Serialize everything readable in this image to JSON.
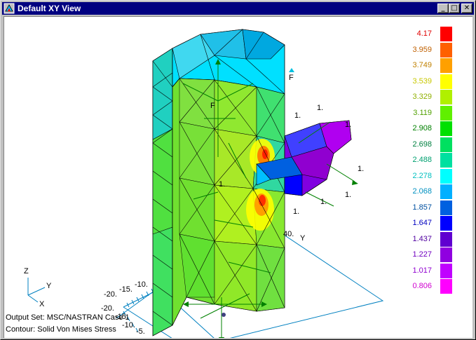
{
  "window": {
    "title": "Default XY View",
    "minimize_glyph": "_",
    "maximize_glyph": "□",
    "close_glyph": "✕"
  },
  "legend": {
    "values": [
      "4.17",
      "3.959",
      "3.749",
      "3.539",
      "3.329",
      "3.119",
      "2.908",
      "2.698",
      "2.488",
      "2.278",
      "2.068",
      "1.857",
      "1.647",
      "1.437",
      "1.227",
      "1.017",
      "0.806"
    ],
    "colors": [
      "#ff0000",
      "#ff6000",
      "#ffa000",
      "#ffff00",
      "#b0f000",
      "#60f000",
      "#00e000",
      "#00e060",
      "#00e0a0",
      "#00ffff",
      "#00b0ff",
      "#0060e0",
      "#0000ff",
      "#6000d0",
      "#9000e0",
      "#c000ff",
      "#ff00ff"
    ],
    "label_colors": [
      "#e00000",
      "#c06000",
      "#c08000",
      "#c8c800",
      "#90b000",
      "#50a000",
      "#008000",
      "#008040",
      "#00a070",
      "#00c0c0",
      "#0090c0",
      "#0050a0",
      "#0000c0",
      "#5000a0",
      "#7000c0",
      "#9000d0",
      "#d000d0"
    ]
  },
  "info": {
    "output_set": "Output Set: MSC/NASTRAN Case 1",
    "contour": "Contour: Solid Von Mises Stress"
  },
  "axes_triad": {
    "z": "Z",
    "y": "Y",
    "x": "X"
  },
  "model_labels": {
    "force_label": "F",
    "force_label_2": "F",
    "constraint_labels": [
      "1.",
      "1.",
      "1.",
      "1.",
      "1.",
      "1.",
      "1.",
      "1."
    ],
    "grid_y_label": "Y",
    "grid_tick_40": "40.",
    "ticks": [
      "-20.",
      "-15.",
      "-10.",
      "-20.",
      "-15.",
      "-10.",
      "-5."
    ]
  },
  "colors": {
    "titlebar": "#000080",
    "viewport_bg": "#ffffff",
    "mesh_lines": "#000000",
    "arrows": "#008000",
    "grid": "#0080c0"
  }
}
